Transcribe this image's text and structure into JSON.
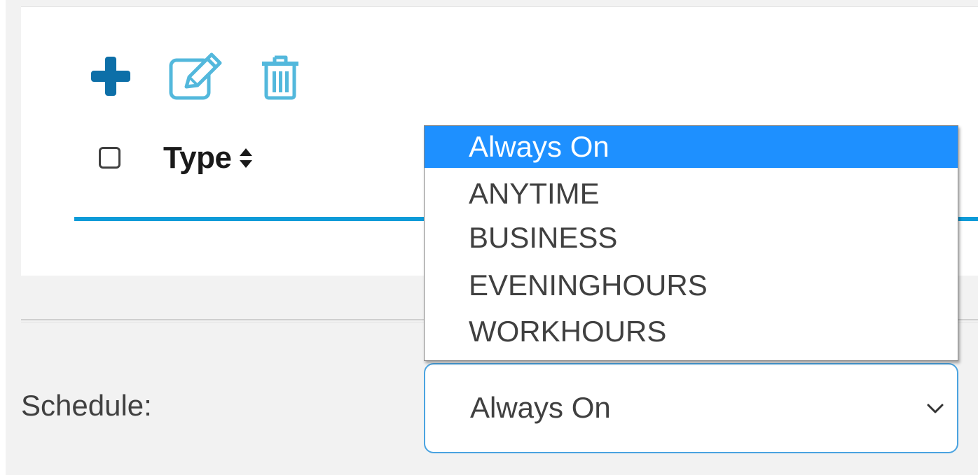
{
  "toolbar": {
    "add_icon": "plus-icon",
    "edit_icon": "edit-icon",
    "delete_icon": "trash-icon",
    "accent_color": "#0d6fa8",
    "icon_color": "#53b8dc"
  },
  "table": {
    "header": {
      "type_label": "Type",
      "sort_icon": "sort-icon"
    },
    "underline_color": "#0d9bd8"
  },
  "schedule": {
    "label": "Schedule:",
    "selected_value": "Always On",
    "chevron_icon": "chevron-down-icon",
    "options": [
      {
        "label": "Always On",
        "selected": true
      },
      {
        "label": "ANYTIME",
        "selected": false
      },
      {
        "label": "BUSINESS",
        "selected": false
      },
      {
        "label": "EVENINGHOURS",
        "selected": false
      },
      {
        "label": "WORKHOURS",
        "selected": false
      }
    ],
    "highlight_color": "#1e90ff"
  }
}
